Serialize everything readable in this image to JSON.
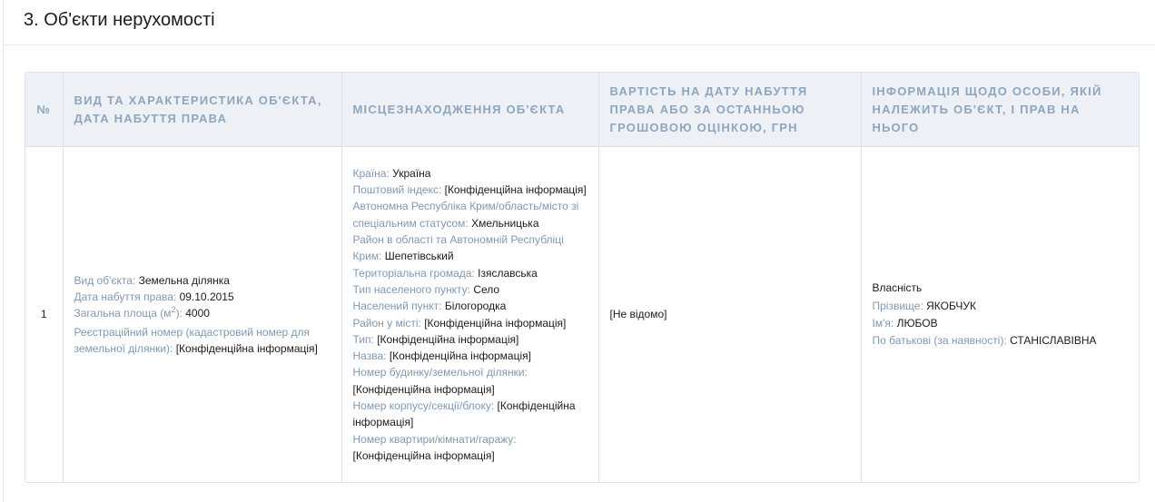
{
  "section": {
    "title": "3. Об'єкти нерухомості"
  },
  "table": {
    "headers": [
      "№",
      "Вид та характеристика об'єкта, дата набуття права",
      "Місцезнаходження об'єкта",
      "Вартість на дату набуття права або за останньою грошовою оцінкою, грн",
      "Інформація щодо особи, якій належить об'єкт, і прав на нього"
    ],
    "row": {
      "num": "1",
      "object": {
        "type_label": "Вид об'єкта:",
        "type_value": "Земельна ділянка",
        "date_label": "Дата набуття права:",
        "date_value": "09.10.2015",
        "area_label_pre": "Загальна площа (м",
        "area_label_sup": "2",
        "area_label_post": "):",
        "area_value": "4000",
        "cadastre_label": "Реєстраційний номер (кадастровий номер для земельної ділянки):",
        "cadastre_value": "[Конфіденційна інформація]"
      },
      "location": [
        {
          "label": "Країна:",
          "value": "Україна"
        },
        {
          "label": "Поштовий індекс:",
          "value": "[Конфіденційна інформація]"
        },
        {
          "label": "Автономна Республіка Крим/область/місто зі спеціальним статусом:",
          "value": "Хмельницька"
        },
        {
          "label": "Район в області та Автономній Республіці Крим:",
          "value": "Шепетівський"
        },
        {
          "label": "Територіальна громада:",
          "value": "Ізяславська"
        },
        {
          "label": "Тип населеного пункту:",
          "value": "Село"
        },
        {
          "label": "Населений пункт:",
          "value": "Білогородка"
        },
        {
          "label": "Район у місті:",
          "value": "[Конфіденційна інформація]"
        },
        {
          "label": "Тип:",
          "value": "[Конфіденційна інформація]"
        },
        {
          "label": "Назва:",
          "value": "[Конфіденційна інформація]"
        },
        {
          "label": "Номер будинку/земельної ділянки:",
          "value": "[Конфіденційна інформація]"
        },
        {
          "label": "Номер корпусу/секції/блоку:",
          "value": "[Конфіденційна інформація]"
        },
        {
          "label": "Номер квартири/кімнати/гаражу:",
          "value": "[Конфіденційна інформація]"
        }
      ],
      "value": "[Не відомо]",
      "owner": {
        "right": "Власність",
        "surname_label": "Прізвище:",
        "surname_value": "ЯКОБЧУК",
        "name_label": "Ім'я:",
        "name_value": "ЛЮБОВ",
        "patronymic_label": "По батькові (за наявності):",
        "patronymic_value": "СТАНІСЛАВІВНА"
      }
    }
  }
}
